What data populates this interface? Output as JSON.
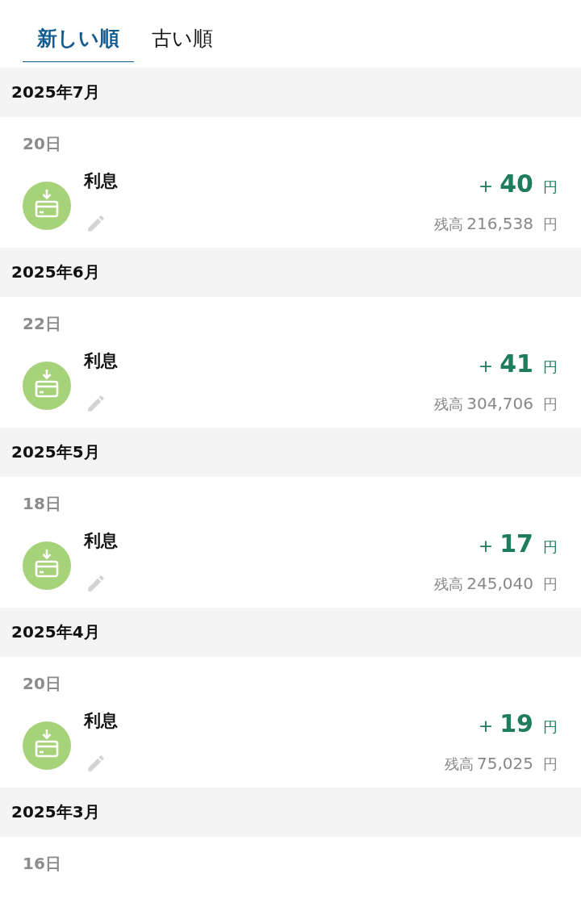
{
  "tabs": [
    {
      "label": "新しい順",
      "selected": true
    },
    {
      "label": "古い順",
      "selected": false
    }
  ],
  "months": [
    {
      "title": "2025年7月",
      "days": [
        {
          "day": "20日",
          "entries": [
            {
              "title": "利息",
              "sign": "+",
              "amount": "40",
              "currency": "円",
              "balance_label": "残高",
              "balance": "216,538",
              "balance_currency": "円"
            }
          ]
        }
      ]
    },
    {
      "title": "2025年6月",
      "days": [
        {
          "day": "22日",
          "entries": [
            {
              "title": "利息",
              "sign": "+",
              "amount": "41",
              "currency": "円",
              "balance_label": "残高",
              "balance": "304,706",
              "balance_currency": "円"
            }
          ]
        }
      ]
    },
    {
      "title": "2025年5月",
      "days": [
        {
          "day": "18日",
          "entries": [
            {
              "title": "利息",
              "sign": "+",
              "amount": "17",
              "currency": "円",
              "balance_label": "残高",
              "balance": "245,040",
              "balance_currency": "円"
            }
          ]
        }
      ]
    },
    {
      "title": "2025年4月",
      "days": [
        {
          "day": "20日",
          "entries": [
            {
              "title": "利息",
              "sign": "+",
              "amount": "19",
              "currency": "円",
              "balance_label": "残高",
              "balance": "75,025",
              "balance_currency": "円"
            }
          ]
        }
      ]
    },
    {
      "title": "2025年3月",
      "days": [
        {
          "day": "16日"
        }
      ]
    }
  ]
}
